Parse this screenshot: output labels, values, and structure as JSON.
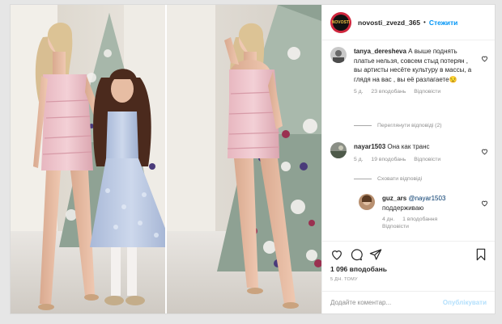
{
  "post": {
    "author": "novosti_zvezd_365",
    "separator": "•",
    "follow_label": "Стежити",
    "avatar_text": "NOVOSTI"
  },
  "comments": [
    {
      "user": "tanya_deresheva",
      "text": "А выше поднять платье нельзя, совсем стыд потерян , вы артисты несёте культуру в массы, а глядя на вас , вы её разлагаете😒",
      "age": "5 д.",
      "likes": "23 вподобань",
      "reply": "Відповісти"
    },
    {
      "user": "nayar1503",
      "text": "Она как транс",
      "age": "5 д.",
      "likes": "19 вподобань",
      "reply": "Відповісти"
    }
  ],
  "view_replies_label": "Переглянути відповіді (2)",
  "hide_replies_label": "Сховати відповіді",
  "reply": {
    "user": "guz_ars",
    "mention": "@nayar1503",
    "text": "поддерживаю",
    "age": "4 дн.",
    "likes": "1 вподобання",
    "reply": "Відповісти"
  },
  "likes_count": "1 096 вподобань",
  "posted_time": "5 ДН. ТОМУ",
  "comment_box": {
    "placeholder": "Додайте коментар...",
    "publish_label": "Опублікувати"
  },
  "icons": {
    "like": "heart-icon",
    "comment": "comment-icon",
    "share": "share-icon",
    "save": "bookmark-icon"
  },
  "colors": {
    "link_blue": "#0095f6",
    "muted": "#8e8e8e",
    "publish_disabled": "#b2dffc"
  }
}
